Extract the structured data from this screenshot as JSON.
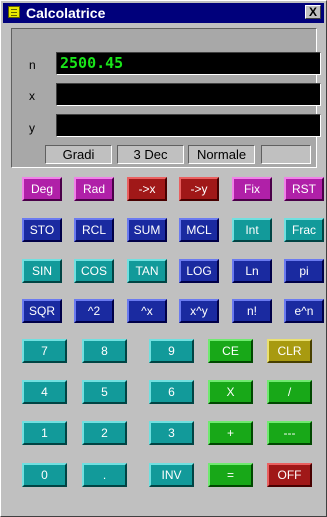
{
  "window": {
    "title": "Calcolatrice",
    "close_label": "X",
    "icon": "calculator-icon"
  },
  "display": {
    "registers": [
      {
        "label": "n",
        "value": "2500.45"
      },
      {
        "label": "x",
        "value": ""
      },
      {
        "label": "y",
        "value": ""
      }
    ],
    "status": [
      "Gradi",
      "3 Dec",
      "Normale",
      ""
    ]
  },
  "keys": [
    [
      {
        "label": "Deg",
        "color": "magenta"
      },
      {
        "label": "Rad",
        "color": "magenta"
      },
      {
        "label": "->x",
        "color": "darkred"
      },
      {
        "label": "->y",
        "color": "darkred"
      },
      {
        "label": "Fix",
        "color": "magenta"
      },
      {
        "label": "RST",
        "color": "magenta"
      }
    ],
    [
      {
        "label": "STO",
        "color": "navy"
      },
      {
        "label": "RCL",
        "color": "navy"
      },
      {
        "label": "SUM",
        "color": "navy"
      },
      {
        "label": "MCL",
        "color": "navy"
      },
      {
        "label": "Int",
        "color": "teal"
      },
      {
        "label": "Frac",
        "color": "teal"
      }
    ],
    [
      {
        "label": "SIN",
        "color": "teal"
      },
      {
        "label": "COS",
        "color": "teal"
      },
      {
        "label": "TAN",
        "color": "teal"
      },
      {
        "label": "LOG",
        "color": "navy"
      },
      {
        "label": "Ln",
        "color": "navy"
      },
      {
        "label": "pi",
        "color": "navy"
      }
    ],
    [
      {
        "label": "SQR",
        "color": "navy"
      },
      {
        "label": "^2",
        "color": "navy"
      },
      {
        "label": "^x",
        "color": "navy"
      },
      {
        "label": "x^y",
        "color": "navy"
      },
      {
        "label": "n!",
        "color": "navy"
      },
      {
        "label": "e^n",
        "color": "navy"
      }
    ],
    [
      {
        "label": "7",
        "color": "teal"
      },
      {
        "label": "8",
        "color": "teal"
      },
      {
        "label": "9",
        "color": "teal"
      },
      {
        "label": "CE",
        "color": "green"
      },
      {
        "label": "CLR",
        "color": "olive"
      }
    ],
    [
      {
        "label": "4",
        "color": "teal"
      },
      {
        "label": "5",
        "color": "teal"
      },
      {
        "label": "6",
        "color": "teal"
      },
      {
        "label": "X",
        "color": "green"
      },
      {
        "label": "/",
        "color": "green"
      }
    ],
    [
      {
        "label": "1",
        "color": "teal"
      },
      {
        "label": "2",
        "color": "teal"
      },
      {
        "label": "3",
        "color": "teal"
      },
      {
        "label": "+",
        "color": "green"
      },
      {
        "label": "---",
        "color": "green"
      }
    ],
    [
      {
        "label": "0",
        "color": "teal"
      },
      {
        "label": ".",
        "color": "teal"
      },
      {
        "label": "INV",
        "color": "teal"
      },
      {
        "label": "=",
        "color": "green"
      },
      {
        "label": "OFF",
        "color": "darkred"
      }
    ]
  ]
}
